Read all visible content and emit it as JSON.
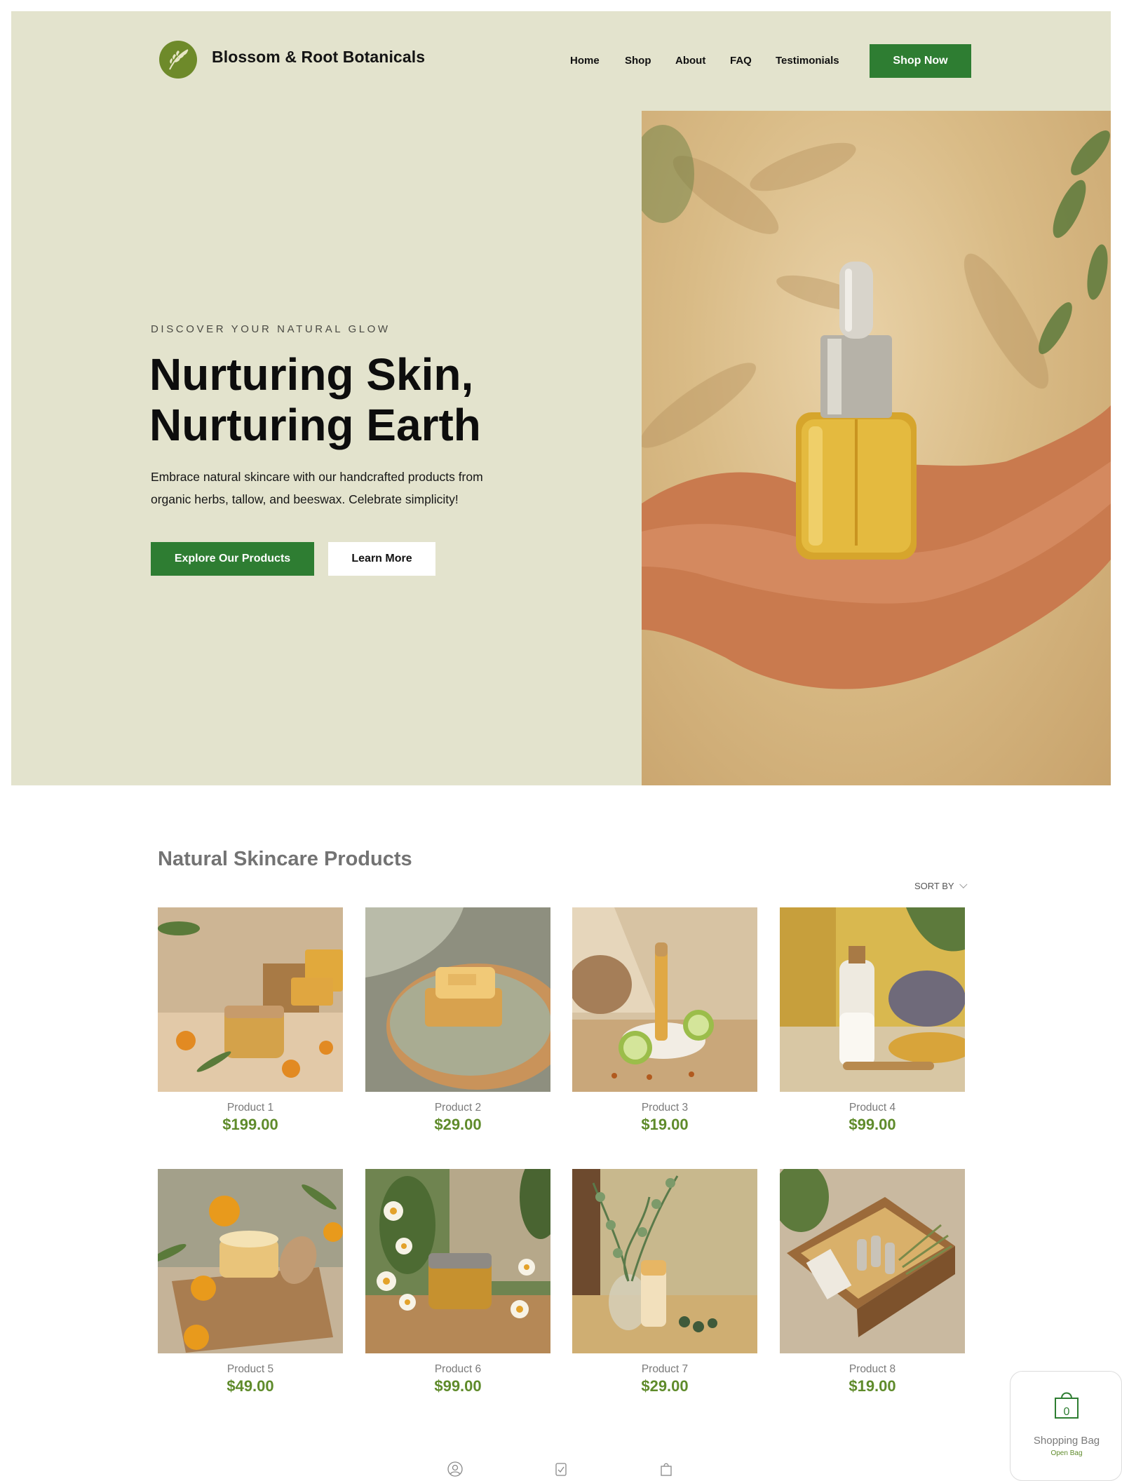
{
  "brand": {
    "name": "Blossom & Root Botanicals"
  },
  "nav": {
    "links": [
      "Home",
      "Shop",
      "About",
      "FAQ",
      "Testimonials"
    ],
    "cta": "Shop Now"
  },
  "hero": {
    "eyebrow": "DISCOVER YOUR NATURAL GLOW",
    "headline_line1": "Nurturing Skin,",
    "headline_line2": "Nurturing Earth",
    "lede": "Embrace natural skincare with our handcrafted products from organic herbs, tallow, and beeswax. Celebrate simplicity!",
    "primary_button": "Explore Our Products",
    "secondary_button": "Learn More"
  },
  "products": {
    "title": "Natural Skincare Products",
    "sort_label": "SORT BY",
    "items": [
      {
        "name": "Product 1",
        "price": "$199.00"
      },
      {
        "name": "Product 2",
        "price": "$29.00"
      },
      {
        "name": "Product 3",
        "price": "$19.00"
      },
      {
        "name": "Product 4",
        "price": "$99.00"
      },
      {
        "name": "Product 5",
        "price": "$49.00"
      },
      {
        "name": "Product 6",
        "price": "$99.00"
      },
      {
        "name": "Product 7",
        "price": "$29.00"
      },
      {
        "name": "Product 8",
        "price": "$19.00"
      }
    ]
  },
  "bag": {
    "count": "0",
    "label": "Shopping Bag",
    "sub": "Open Bag"
  },
  "colors": {
    "accent_green": "#2e7d32",
    "price_green": "#5f8b2b",
    "hero_bg": "#e3e3cd"
  },
  "footer_icons": [
    "user-icon",
    "clipboard-check-icon",
    "shopping-bag-icon"
  ]
}
